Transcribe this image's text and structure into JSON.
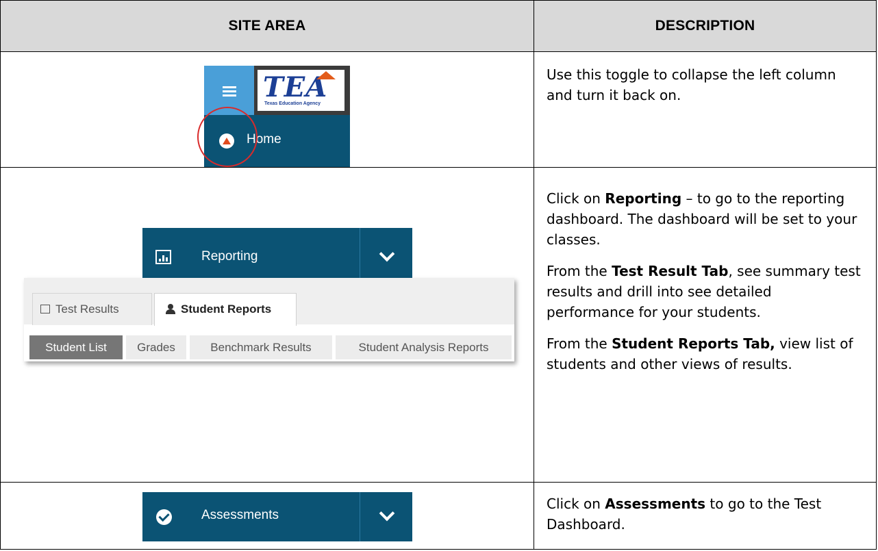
{
  "table": {
    "headers": {
      "site_area": "SITE AREA",
      "description": "DESCRIPTION"
    }
  },
  "row1": {
    "logo_text": "TEA",
    "logo_subtext": "Texas Education Agency",
    "home_label": "Home",
    "description": "Use this toggle to collapse the left column and turn it back on."
  },
  "row2": {
    "reporting_label": "Reporting",
    "tabs": {
      "test_results": "Test Results",
      "student_reports": "Student Reports"
    },
    "subtabs": [
      "Student List",
      "Grades",
      "Benchmark Results",
      "Student Analysis Reports"
    ],
    "desc": {
      "p1_pre": "Click on ",
      "p1_bold": "Reporting",
      "p1_post": " – to go to the reporting dashboard. The dashboard will be set to your classes.",
      "p2_pre": "From the ",
      "p2_bold": "Test Result Tab",
      "p2_post": ", see summary test results and drill into see detailed performance for your students.",
      "p3_pre": "From the ",
      "p3_bold": "Student Reports Tab,",
      "p3_post": " view list of students and other views of results."
    }
  },
  "row3": {
    "assessments_label": "Assessments",
    "desc": {
      "pre": "Click on ",
      "bold": "Assessments",
      "post": " to go to the Test Dashboard."
    }
  },
  "colors": {
    "nav_blue": "#0b5374",
    "toggle_blue": "#4a9fd8",
    "header_gray": "#d9d9d9",
    "highlight_red": "#d92b2b",
    "logo_blue": "#1c3f95",
    "logo_orange": "#e35c1a"
  },
  "icons": [
    "hamburger-icon",
    "home-icon",
    "chart-icon",
    "chevron-down-icon",
    "person-icon",
    "check-circle-icon"
  ]
}
